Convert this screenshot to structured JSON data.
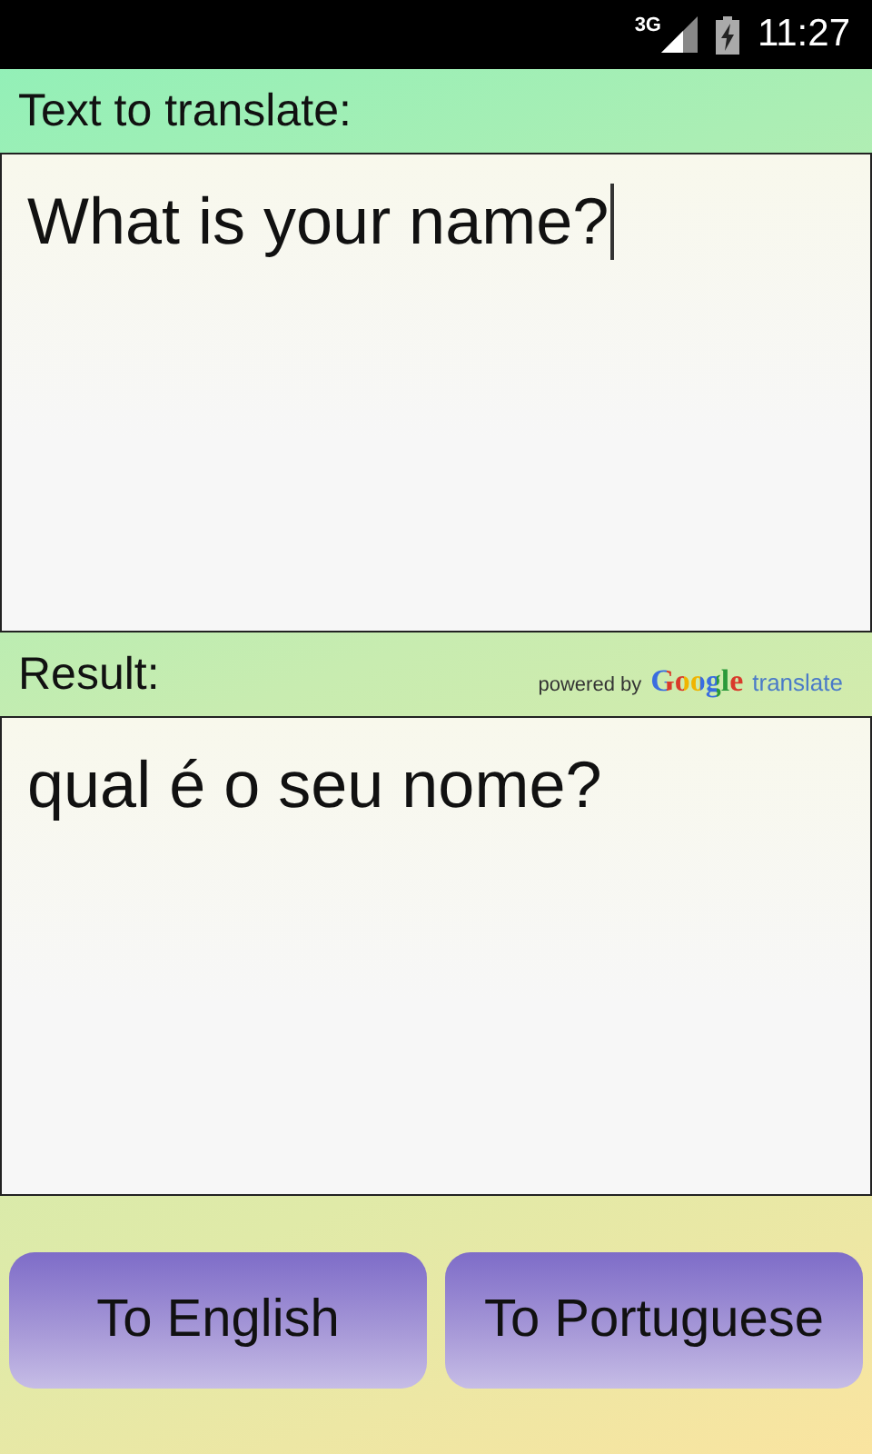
{
  "status_bar": {
    "network": "3G",
    "time": "11:27"
  },
  "input": {
    "label": "Text to translate:",
    "value": "What is your name?"
  },
  "result": {
    "label": "Result:",
    "text": "qual é o seu nome?",
    "attribution": {
      "prefix": "powered by",
      "brand": "Google",
      "service": "translate"
    }
  },
  "buttons": [
    {
      "label": "To English"
    },
    {
      "label": "To Portuguese"
    }
  ]
}
